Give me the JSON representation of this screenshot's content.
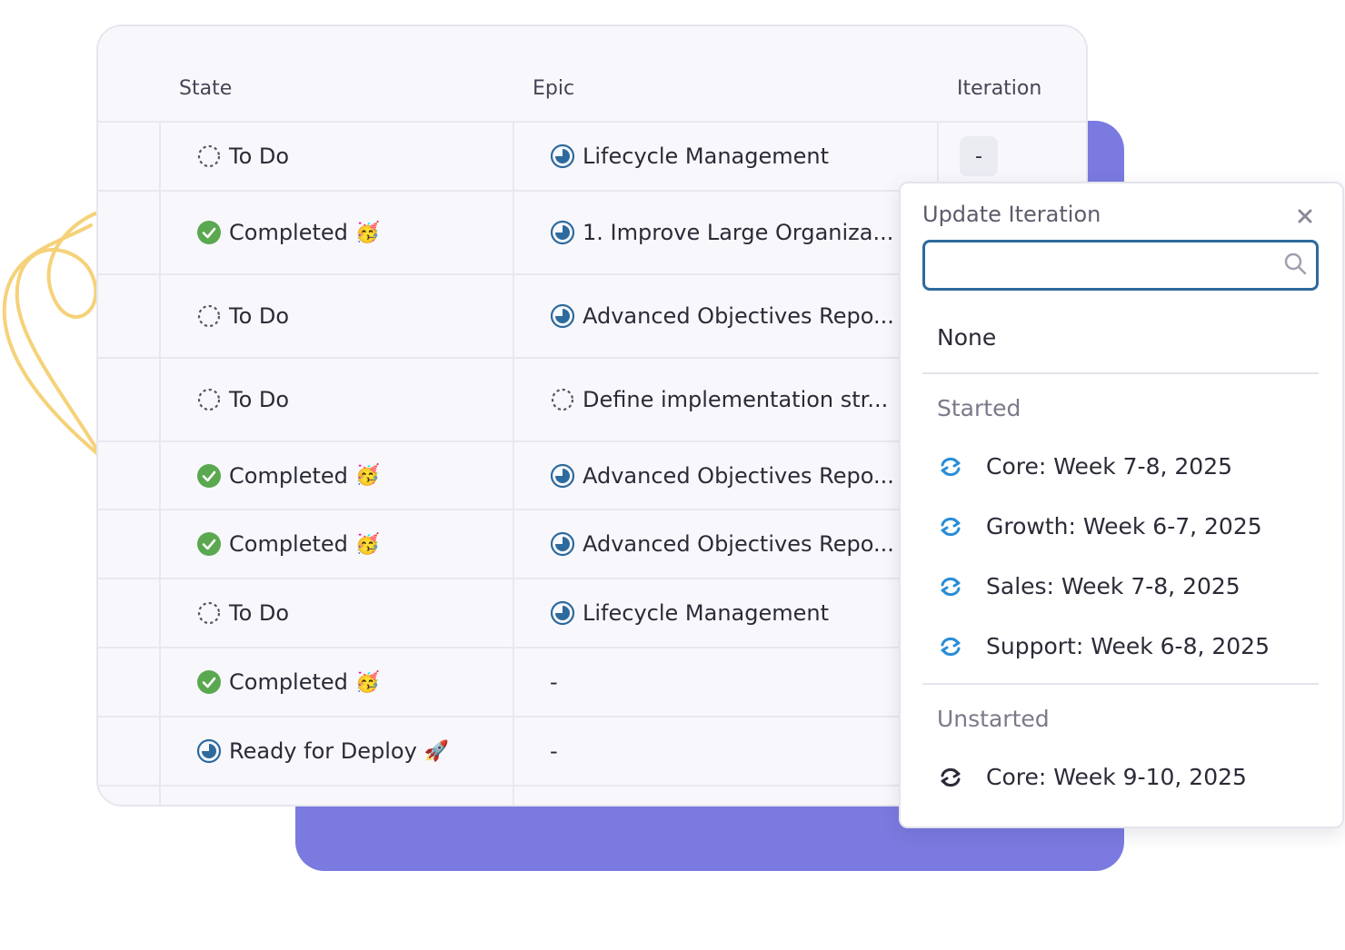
{
  "table": {
    "headers": {
      "state": "State",
      "epic": "Epic",
      "iteration": "Iteration"
    },
    "rows": [
      {
        "state": "To Do",
        "state_icon": "todo-circle-icon",
        "state_emoji": "",
        "epic": "Lifecycle Management",
        "epic_icon": "in-progress-circle-icon",
        "iteration": "-"
      },
      {
        "state": "Completed",
        "state_icon": "check-circle-icon",
        "state_emoji": "🥳",
        "epic": "1. Improve Large Organiza...",
        "epic_icon": "in-progress-circle-icon"
      },
      {
        "state": "To Do",
        "state_icon": "todo-circle-icon",
        "state_emoji": "",
        "epic": "Advanced Objectives Repo...",
        "epic_icon": "in-progress-circle-icon"
      },
      {
        "state": "To Do",
        "state_icon": "todo-circle-icon",
        "state_emoji": "",
        "epic": "Define implementation str...",
        "epic_icon": "todo-circle-icon"
      },
      {
        "state": "Completed",
        "state_icon": "check-circle-icon",
        "state_emoji": "🥳",
        "epic": "Advanced Objectives Repo...",
        "epic_icon": "in-progress-circle-icon"
      },
      {
        "state": "Completed",
        "state_icon": "check-circle-icon",
        "state_emoji": "🥳",
        "epic": "Advanced Objectives Repo...",
        "epic_icon": "in-progress-circle-icon"
      },
      {
        "state": "To Do",
        "state_icon": "todo-circle-icon",
        "state_emoji": "",
        "epic": "Lifecycle Management",
        "epic_icon": "in-progress-circle-icon"
      },
      {
        "state": "Completed",
        "state_icon": "check-circle-icon",
        "state_emoji": "🥳",
        "epic": "-",
        "epic_icon": ""
      },
      {
        "state": "Ready for Deploy",
        "state_icon": "in-progress-circle-icon",
        "state_emoji": "🚀",
        "epic": "-",
        "epic_icon": ""
      }
    ]
  },
  "popup": {
    "title": "Update Iteration",
    "close_icon": "close-icon",
    "search_value": "",
    "search_icon": "search-icon",
    "none_option": "None",
    "groups": [
      {
        "label": "Started",
        "items": [
          "Core: Week 7-8, 2025",
          "Growth: Week 6-7, 2025",
          "Sales: Week 7-8, 2025",
          "Support: Week 6-8, 2025"
        ]
      },
      {
        "label": "Unstarted",
        "items": [
          "Core: Week 9-10, 2025"
        ]
      }
    ]
  },
  "colors": {
    "accent_blue": "#2d6a9e",
    "done_green": "#5aa84f",
    "purple_card": "#7b7ae0",
    "started_cycle": "#2a8dd6",
    "unstarted_cycle": "#2b2b38"
  }
}
